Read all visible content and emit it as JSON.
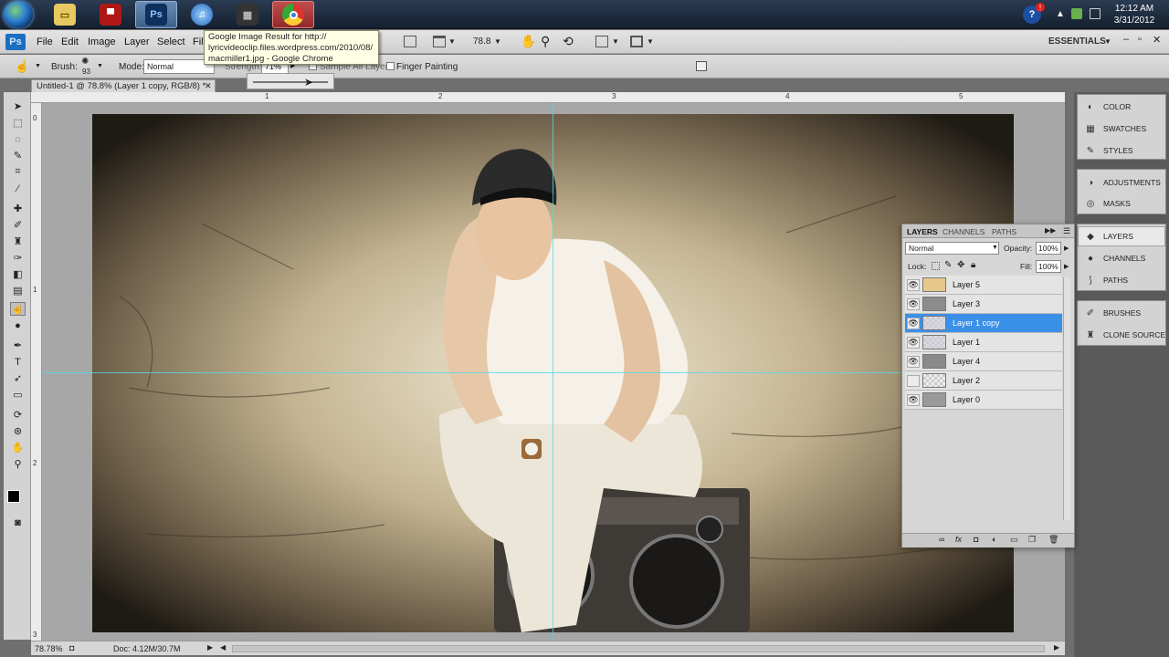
{
  "taskbar": {
    "clock_time": "12:12 AM",
    "clock_date": "3/31/2012",
    "apps": [
      {
        "name": "Windows Explorer",
        "icon": "folder-icon",
        "glyph": "📁"
      },
      {
        "name": "Media app",
        "icon": "media-icon",
        "glyph": "▀"
      },
      {
        "name": "Photoshop",
        "icon": "photoshop-icon",
        "glyph": "Ps"
      },
      {
        "name": "iTunes",
        "icon": "itunes-icon",
        "glyph": "♫"
      },
      {
        "name": "Video app",
        "icon": "film-icon",
        "glyph": "▦"
      },
      {
        "name": "Google Chrome",
        "icon": "chrome-icon",
        "glyph": "◉"
      }
    ]
  },
  "tooltip": {
    "line1": "Google Image Result for http://",
    "line2": "lyricvideoclip.files.wordpress.com/2010/08/",
    "line3": "macmiller1.jpg - Google Chrome"
  },
  "menubar": {
    "badge": "Ps",
    "items": [
      "File",
      "Edit",
      "Image",
      "Layer",
      "Select",
      "Filt"
    ],
    "zoom": "78.8",
    "workspace": "ESSENTIALS"
  },
  "options": {
    "brush_label": "Brush:",
    "brush_size": "93",
    "mode_label": "Mode:",
    "mode_value": "Normal",
    "strength_label": "Strength:",
    "strength_value": "71%",
    "sample_all": "Sample All Layers",
    "finger_painting": "Finger Painting"
  },
  "document": {
    "tab_title": "Untitled-1 @ 78.8% (Layer 1 copy, RGB/8) *",
    "ruler_top": [
      "1",
      "2",
      "3",
      "4",
      "5"
    ],
    "ruler_left": [
      "1",
      "2",
      "3"
    ],
    "status_zoom": "78.78%",
    "status_doc": "Doc: 4.12M/30.7M"
  },
  "dock": {
    "group1": [
      "COLOR",
      "SWATCHES",
      "STYLES"
    ],
    "group2": [
      "ADJUSTMENTS",
      "MASKS"
    ],
    "group3": [
      "LAYERS",
      "CHANNELS",
      "PATHS"
    ],
    "group4": [
      "BRUSHES",
      "CLONE SOURCE"
    ]
  },
  "layers_panel": {
    "tabs": [
      "LAYERS",
      "CHANNELS",
      "PATHS"
    ],
    "blend_mode": "Normal",
    "opacity_label": "Opacity:",
    "opacity_value": "100%",
    "lock_label": "Lock:",
    "fill_label": "Fill:",
    "fill_value": "100%",
    "layers": [
      {
        "name": "Layer 5",
        "visible": true,
        "selected": false,
        "thumb": "#e8c88a"
      },
      {
        "name": "Layer 3",
        "visible": true,
        "selected": false,
        "thumb": "#8c8c8c"
      },
      {
        "name": "Layer 1 copy",
        "visible": true,
        "selected": true,
        "thumb": "#d8d8e8"
      },
      {
        "name": "Layer 1",
        "visible": true,
        "selected": false,
        "thumb": "#d8d8e8"
      },
      {
        "name": "Layer 4",
        "visible": true,
        "selected": false,
        "thumb": "#8a8a8a"
      },
      {
        "name": "Layer 2",
        "visible": false,
        "selected": false,
        "thumb": "#eeeeee"
      },
      {
        "name": "Layer 0",
        "visible": true,
        "selected": false,
        "thumb": "#9a9a9a"
      }
    ]
  }
}
